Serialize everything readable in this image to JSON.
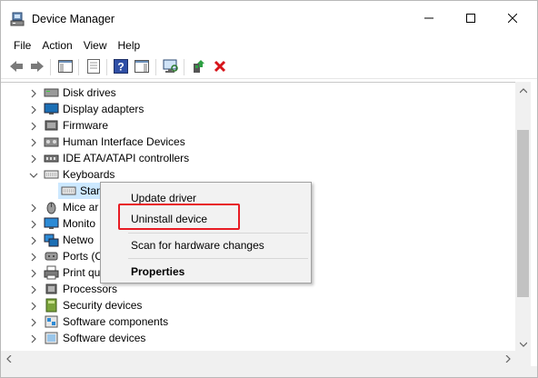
{
  "window": {
    "title": "Device Manager",
    "icons": {
      "app": "device-manager-icon",
      "minimize": "minimize-icon",
      "maximize": "maximize-icon",
      "close": "close-icon"
    }
  },
  "menu": [
    "File",
    "Action",
    "View",
    "Help"
  ],
  "toolbar": [
    {
      "name": "back-icon"
    },
    {
      "name": "forward-icon"
    },
    {
      "name": "show-hide-console-tree-icon"
    },
    {
      "name": "properties-icon"
    },
    {
      "name": "help-icon"
    },
    {
      "name": "action-pane-icon"
    },
    {
      "name": "scan-hardware-icon"
    },
    {
      "name": "update-driver-icon"
    },
    {
      "name": "uninstall-device-icon"
    }
  ],
  "tree": {
    "nodes": [
      {
        "label": "Disk drives",
        "icon": "disk-drive-icon",
        "expanded": false
      },
      {
        "label": "Display adapters",
        "icon": "display-adapter-icon",
        "expanded": false
      },
      {
        "label": "Firmware",
        "icon": "firmware-icon",
        "expanded": false
      },
      {
        "label": "Human Interface Devices",
        "icon": "hid-icon",
        "expanded": false
      },
      {
        "label": "IDE ATA/ATAPI controllers",
        "icon": "ide-controller-icon",
        "expanded": false
      },
      {
        "label": "Keyboards",
        "icon": "keyboard-icon",
        "expanded": true
      },
      {
        "label": "Stan",
        "icon": "keyboard-icon",
        "child": true,
        "selected": true
      },
      {
        "label": "Mice ar",
        "icon": "mouse-icon",
        "expanded": false
      },
      {
        "label": "Monito",
        "icon": "monitor-icon",
        "expanded": false
      },
      {
        "label": "Netwo",
        "icon": "network-adapter-icon",
        "expanded": false
      },
      {
        "label": "Ports (C",
        "icon": "ports-icon",
        "expanded": false
      },
      {
        "label": "Print qu",
        "icon": "print-queue-icon",
        "expanded": false
      },
      {
        "label": "Processors",
        "icon": "processor-icon",
        "expanded": false
      },
      {
        "label": "Security devices",
        "icon": "security-device-icon",
        "expanded": false
      },
      {
        "label": "Software components",
        "icon": "software-component-icon",
        "expanded": false
      },
      {
        "label": "Software devices",
        "icon": "software-device-icon",
        "expanded": false
      }
    ]
  },
  "context_menu": {
    "items": [
      {
        "label": "Update driver"
      },
      {
        "label": "Uninstall device",
        "highlighted": true
      },
      {
        "label": "Scan for hardware changes"
      },
      {
        "label": "Properties",
        "bold": true
      }
    ]
  },
  "colors": {
    "selection": "#cce8ff",
    "highlight_border": "#e81c24",
    "menu_bg": "#f2f2f2"
  }
}
